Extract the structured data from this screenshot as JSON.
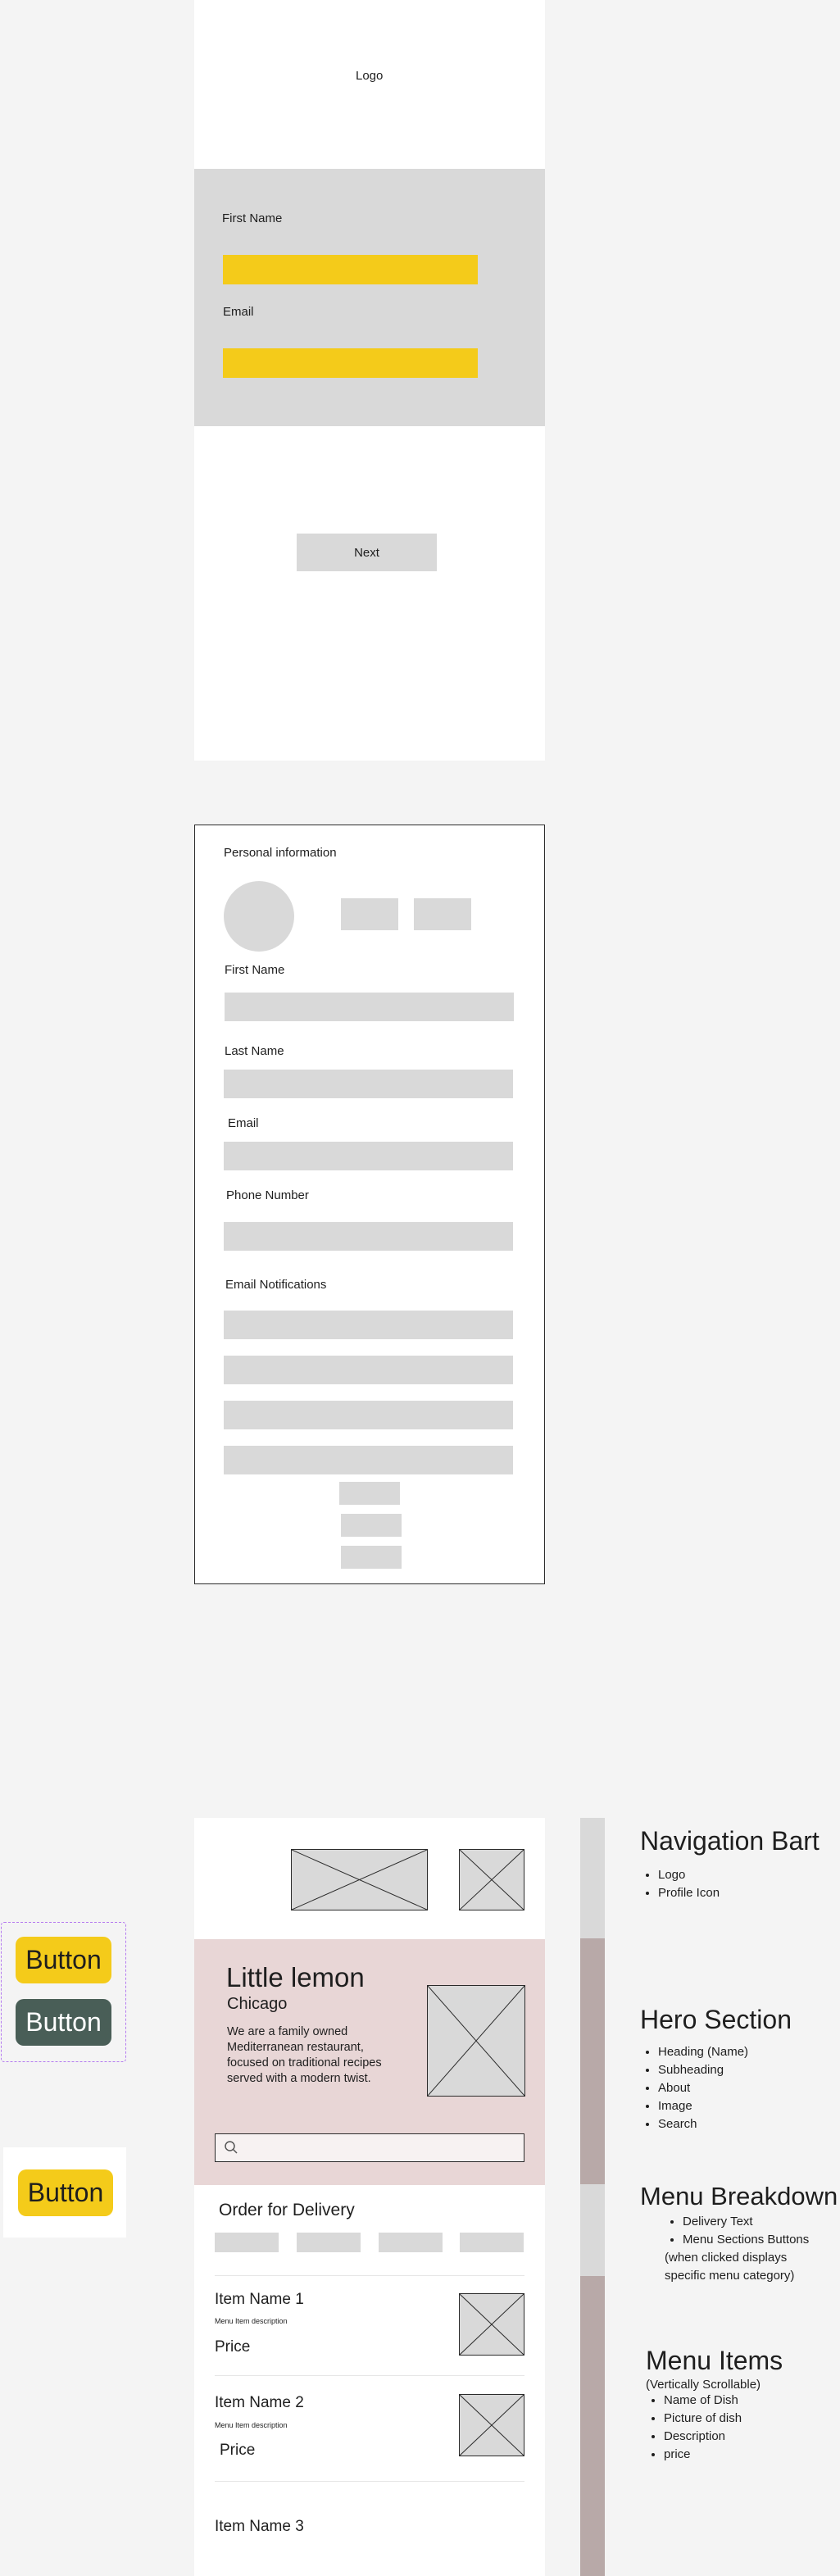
{
  "screen1": {
    "logo": "Logo",
    "first_name_label": "First Name",
    "email_label": "Email",
    "next_button": "Next"
  },
  "screen2": {
    "title": "Personal information",
    "first_name_label": "First Name",
    "last_name_label": "Last Name",
    "email_label": "Email",
    "phone_label": "Phone Number",
    "notifications_label": "Email Notifications"
  },
  "components": {
    "button_primary": "Button",
    "button_secondary": "Button",
    "button_standalone": "Button",
    "colors": {
      "primary": "#f4cb1a",
      "secondary": "#495e57",
      "hero_bg": "#e8d6d6"
    }
  },
  "home": {
    "hero": {
      "title": "Little lemon",
      "subtitle": "Chicago",
      "description": "We are a family owned Mediterranean restaurant, focused on traditional recipes served with a modern twist."
    },
    "search": {
      "icon": "search-icon"
    },
    "order_heading": "Order for Delivery",
    "items": [
      {
        "name": "Item Name 1",
        "description": "Menu Item description",
        "price": "Price"
      },
      {
        "name": "Item Name 2",
        "description": "Menu Item description",
        "price": "Price"
      },
      {
        "name": "Item Name 3"
      }
    ]
  },
  "annotations": {
    "navigation": {
      "title": "Navigation Bart",
      "items": [
        "Logo",
        "Profile Icon"
      ]
    },
    "hero": {
      "title": "Hero Section",
      "items": [
        "Heading (Name)",
        "Subheading",
        "About",
        "Image",
        "Search"
      ]
    },
    "menu_breakdown": {
      "title": "Menu Breakdown",
      "items": [
        "Delivery Text",
        "Menu Sections Buttons"
      ],
      "note": "(when clicked displays specific menu category)"
    },
    "menu_items": {
      "title": "Menu Items",
      "note": "(Vertically Scrollable)",
      "items": [
        "Name of Dish",
        "Picture of dish",
        "Description",
        "price"
      ]
    }
  }
}
